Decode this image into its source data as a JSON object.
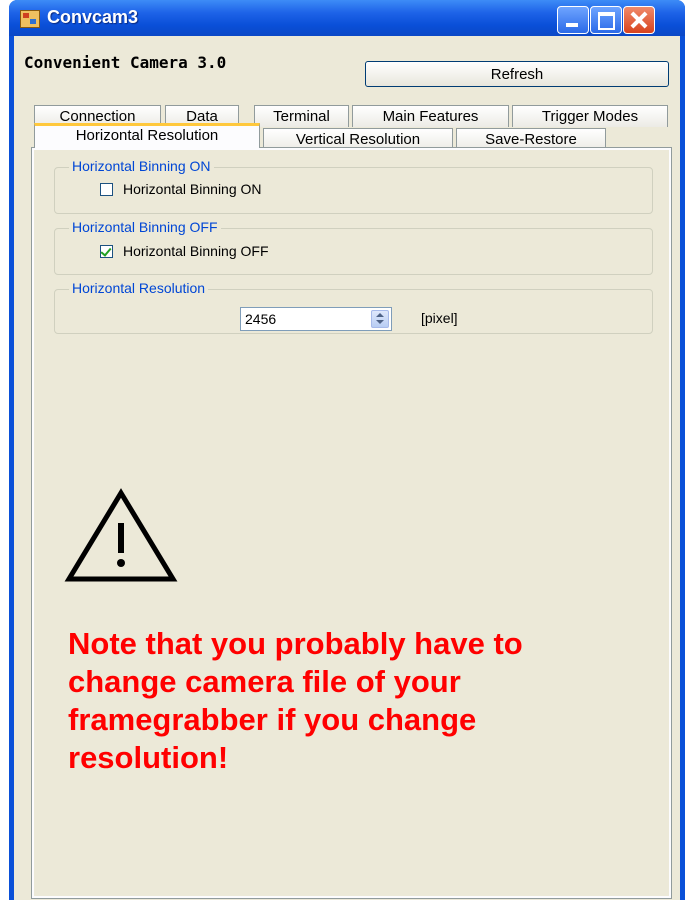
{
  "window": {
    "title": "Convcam3",
    "icon": "app-icon",
    "controls": [
      "minimize-icon",
      "maximize-icon",
      "close-icon"
    ]
  },
  "heading": "Convenient Camera 3.0",
  "refresh_label": "Refresh",
  "tabs_row1": [
    {
      "label": "Connection"
    },
    {
      "label": "Data"
    },
    {
      "label": "Terminal"
    },
    {
      "label": "Main Features"
    },
    {
      "label": "Trigger Modes"
    }
  ],
  "tabs_row2": [
    {
      "label": "Horizontal Resolution",
      "selected": true
    },
    {
      "label": "Vertical Resolution"
    },
    {
      "label": "Save-Restore"
    }
  ],
  "panel": {
    "binning_on": {
      "group_title": "Horizontal Binning ON",
      "label": "Horizontal Binning ON",
      "checked": false
    },
    "binning_off": {
      "group_title": "Horizontal Binning OFF",
      "label": "Horizontal Binning OFF",
      "checked": true
    },
    "resolution": {
      "group_title": "Horizontal Resolution",
      "value": "2456",
      "unit": "[pixel]"
    }
  },
  "warning_icon": "warning-icon",
  "note": "Note that you probably have to change camera file of your framegrabber if you change resolution!",
  "colors": {
    "title_bar": "#0a4fd8",
    "note": "#ff0000",
    "group_title": "#0046d5",
    "active_tab_accent": "#ffc83c"
  }
}
